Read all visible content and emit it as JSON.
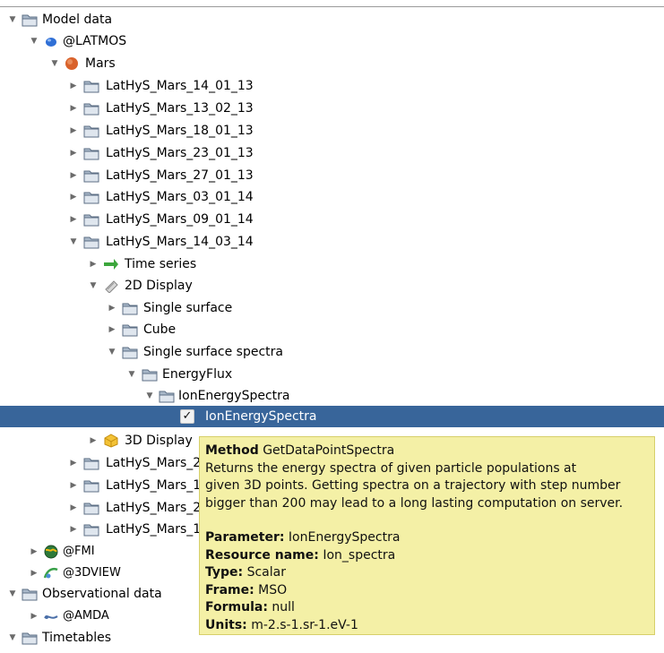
{
  "tree": {
    "model_data": "Model data",
    "latmos": "@LATMOS",
    "mars": "Mars",
    "runs_top": [
      "LatHyS_Mars_14_01_13",
      "LatHyS_Mars_13_02_13",
      "LatHyS_Mars_18_01_13",
      "LatHyS_Mars_23_01_13",
      "LatHyS_Mars_27_01_13",
      "LatHyS_Mars_03_01_14",
      "LatHyS_Mars_09_01_14"
    ],
    "run_open": "LatHyS_Mars_14_03_14",
    "time_series": "Time series",
    "display_2d": "2D Display",
    "single_surface": "Single surface",
    "cube": "Cube",
    "single_surface_spectra": "Single surface spectra",
    "energy_flux": "EnergyFlux",
    "ion_energy_spectra_folder": "IonEnergySpectra",
    "ion_energy_spectra_item": "IonEnergySpectra",
    "display_3d": "3D Display",
    "runs_bottom": [
      "LatHyS_Mars_2",
      "LatHyS_Mars_1",
      "LatHyS_Mars_2",
      "LatHyS_Mars_1"
    ],
    "fmi": "@FMI",
    "view3d": "@3DVIEW",
    "observational_data": "Observational data",
    "amda": "@AMDA",
    "timetables": "Timetables"
  },
  "tooltip": {
    "method_key": "Method",
    "method_value": "GetDataPointSpectra",
    "desc1": "Returns the energy spectra of given particle populations at",
    "desc2": "given 3D points. Getting spectra on a trajectory with step number",
    "desc3": "bigger than 200 may lead to a long lasting computation on server.",
    "parameter_key": "Parameter:",
    "parameter_value": "IonEnergySpectra",
    "resource_key": "Resource name:",
    "resource_value": "Ion_spectra",
    "type_key": "Type:",
    "type_value": "Scalar",
    "frame_key": "Frame:",
    "frame_value": "MSO",
    "formula_key": "Formula:",
    "formula_value": "null",
    "units_key": "Units:",
    "units_value": "m-2.s-1.sr-1.eV-1"
  },
  "colors": {
    "selection": "#38659a",
    "tooltip_bg": "#f4f0a6",
    "folder": "#a9b8c9"
  }
}
